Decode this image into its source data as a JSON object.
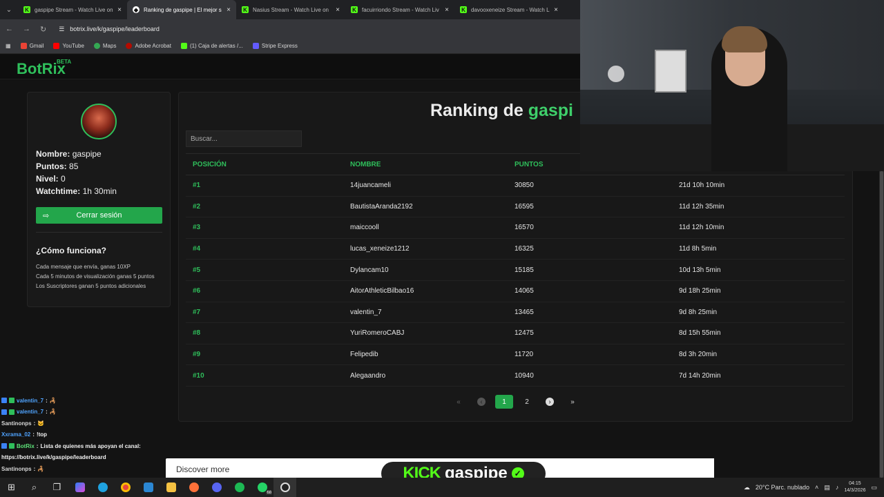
{
  "browser": {
    "tabs": [
      {
        "title": "gaspipe Stream - Watch Live on",
        "icon": "kick-icon",
        "active": false
      },
      {
        "title": "Ranking de gaspipe | El mejor s",
        "icon": "botrix-icon",
        "active": true
      },
      {
        "title": "Nasius Stream - Watch Live on",
        "icon": "kick-icon",
        "active": false
      },
      {
        "title": "facuirriondo Stream - Watch Liv",
        "icon": "kick-icon",
        "active": false
      },
      {
        "title": "davooxeneize Stream - Watch L",
        "icon": "kick-icon",
        "active": false
      }
    ],
    "url": "botrix.live/k/gaspipe/leaderboard",
    "bookmarks": [
      {
        "label": "Gmail",
        "color": "#ea4335"
      },
      {
        "label": "YouTube",
        "color": "#ff0000"
      },
      {
        "label": "Maps",
        "color": "#34a853"
      },
      {
        "label": "Adobe Acrobat",
        "color": "#b30b00"
      },
      {
        "label": "(1) Caja de alertas /...",
        "color": "#53fc18"
      },
      {
        "label": "Stripe Express",
        "color": "#635bff"
      }
    ]
  },
  "site": {
    "logo": "BotRix",
    "logo_tag": "BETA",
    "accent": "#2fbf5b"
  },
  "profile": {
    "nombre_label": "Nombre:",
    "nombre": "gaspipe",
    "puntos_label": "Puntos:",
    "puntos": "85",
    "nivel_label": "Nivel:",
    "nivel": "0",
    "watch_label": "Watchtime:",
    "watchtime": "1h 30min",
    "logout": "Cerrar sesión",
    "how_title": "¿Cómo funciona?",
    "how_lines": [
      "Cada mensaje que envía, ganas 10XP",
      "Cada 5 minutos de visualización ganas 5 puntos",
      "Los Suscriptores ganan 5 puntos adicionales"
    ]
  },
  "ranking": {
    "title_prefix": "Ranking de ",
    "title_name": "gaspi",
    "search_placeholder": "Buscar...",
    "headers": [
      "POSICIÓN",
      "NOMBRE",
      "PUNTOS"
    ],
    "rows": [
      {
        "pos": "#1",
        "name": "14juancameli",
        "points": "30850",
        "time": "21d 10h 10min"
      },
      {
        "pos": "#2",
        "name": "BautistaAranda2192",
        "points": "16595",
        "time": "11d 12h 35min"
      },
      {
        "pos": "#3",
        "name": "maiccooll",
        "points": "16570",
        "time": "11d 12h 10min"
      },
      {
        "pos": "#4",
        "name": "lucas_xeneize1212",
        "points": "16325",
        "time": "11d 8h 5min"
      },
      {
        "pos": "#5",
        "name": "Dylancam10",
        "points": "15185",
        "time": "10d 13h 5min"
      },
      {
        "pos": "#6",
        "name": "AitorAthleticBilbao16",
        "points": "14065",
        "time": "9d 18h 25min"
      },
      {
        "pos": "#7",
        "name": "valentin_7",
        "points": "13465",
        "time": "9d 8h 25min"
      },
      {
        "pos": "#8",
        "name": "YuriRomeroCABJ",
        "points": "12475",
        "time": "8d 15h 55min"
      },
      {
        "pos": "#9",
        "name": "Felipedib",
        "points": "11720",
        "time": "8d 3h 20min"
      },
      {
        "pos": "#10",
        "name": "Alegaandro",
        "points": "10940",
        "time": "7d 14h 20min"
      }
    ],
    "pages": [
      "1",
      "2"
    ],
    "first": "«",
    "prev": "‹",
    "next": "›",
    "last": "»"
  },
  "chat": [
    {
      "user": "valentin_7",
      "msg": "🦂",
      "userClass": "u1"
    },
    {
      "user": "valentin_7",
      "msg": "🦂",
      "userClass": "u1"
    },
    {
      "user": "Santinonps",
      "msg": "🐱",
      "userClass": "u2"
    },
    {
      "user": "Xxrama_02",
      "msg": "!top",
      "userClass": "u3"
    },
    {
      "user": "BotRix",
      "msg": "Lista de quienes más apoyan el canal:",
      "userClass": "u4"
    },
    {
      "user": "",
      "msg": "https://botrix.live/k/gaspipe/leaderboard",
      "userClass": "u2"
    },
    {
      "user": "Santinonps",
      "msg": "🦂",
      "userClass": "u2"
    }
  ],
  "overlay": {
    "discover": "Discover more",
    "kick": "KICK",
    "channel": "gaspipe"
  },
  "taskbar": {
    "weather": "20°C  Parc. nublado",
    "time": "04:15",
    "date": "14/3/2026",
    "whatsapp_badge": "68"
  }
}
